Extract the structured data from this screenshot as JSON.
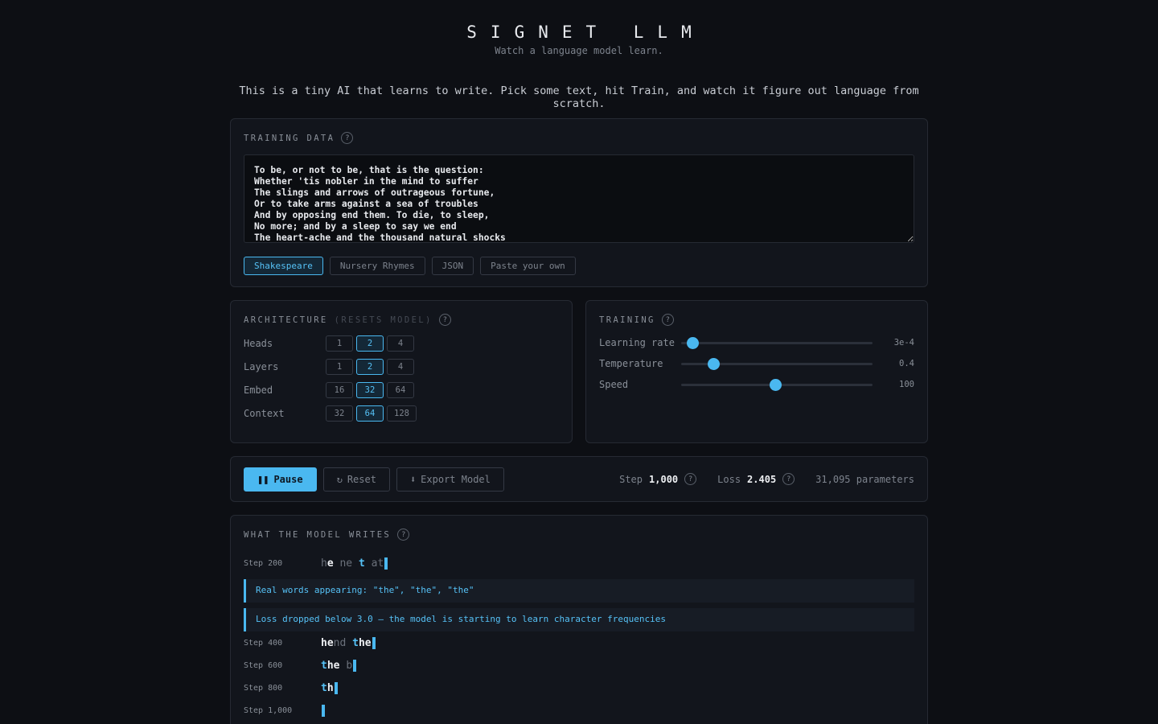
{
  "header": {
    "title": "SIGNET LLM",
    "subtitle": "Watch a language model learn.",
    "intro": "This is a tiny AI that learns to write. Pick some text, hit Train, and watch it figure out language from scratch."
  },
  "training_data": {
    "label": "TRAINING DATA",
    "help": "?",
    "text": "To be, or not to be, that is the question:\nWhether 'tis nobler in the mind to suffer\nThe slings and arrows of outrageous fortune,\nOr to take arms against a sea of troubles\nAnd by opposing end them. To die, to sleep,\nNo more; and by a sleep to say we end\nThe heart-ache and the thousand natural shocks",
    "presets": [
      "Shakespeare",
      "Nursery Rhymes",
      "JSON",
      "Paste your own"
    ],
    "active_preset": "Shakespeare"
  },
  "architecture": {
    "label": "ARCHITECTURE",
    "sublabel": "(RESETS MODEL)",
    "help": "?",
    "rows": [
      {
        "name": "Heads",
        "options": [
          "1",
          "2",
          "4"
        ],
        "selected": "2"
      },
      {
        "name": "Layers",
        "options": [
          "1",
          "2",
          "4"
        ],
        "selected": "2"
      },
      {
        "name": "Embed",
        "options": [
          "16",
          "32",
          "64"
        ],
        "selected": "32"
      },
      {
        "name": "Context",
        "options": [
          "32",
          "64",
          "128"
        ],
        "selected": "64"
      }
    ]
  },
  "training": {
    "label": "TRAINING",
    "help": "?",
    "sliders": [
      {
        "name": "Learning rate",
        "value": "3e-4",
        "fraction": 0.06
      },
      {
        "name": "Temperature",
        "value": "0.4",
        "fraction": 0.17
      },
      {
        "name": "Speed",
        "value": "100",
        "fraction": 0.49
      }
    ]
  },
  "controls": {
    "pause_icon": "pause-icon",
    "pause_label": "Pause",
    "reset_label": "Reset",
    "export_label": "Export Model",
    "step_label": "Step",
    "step_value": "1,000",
    "loss_label": "Loss",
    "loss_value": "2.405",
    "params": "31,095 parameters",
    "help": "?"
  },
  "output": {
    "label": "WHAT THE MODEL WRITES",
    "help": "?",
    "gen_200": {
      "step": "Step 200"
    },
    "note_1": "Real words appearing: \"the\", \"the\", \"the\"",
    "note_2": "Loss dropped below 3.0 — the model is starting to learn character frequencies",
    "gen_400": {
      "step": "Step 400"
    },
    "gen_600": {
      "step": "Step 600"
    },
    "gen_800": {
      "step": "Step 800"
    },
    "gen_1000": {
      "step": "Step 1,000"
    }
  }
}
